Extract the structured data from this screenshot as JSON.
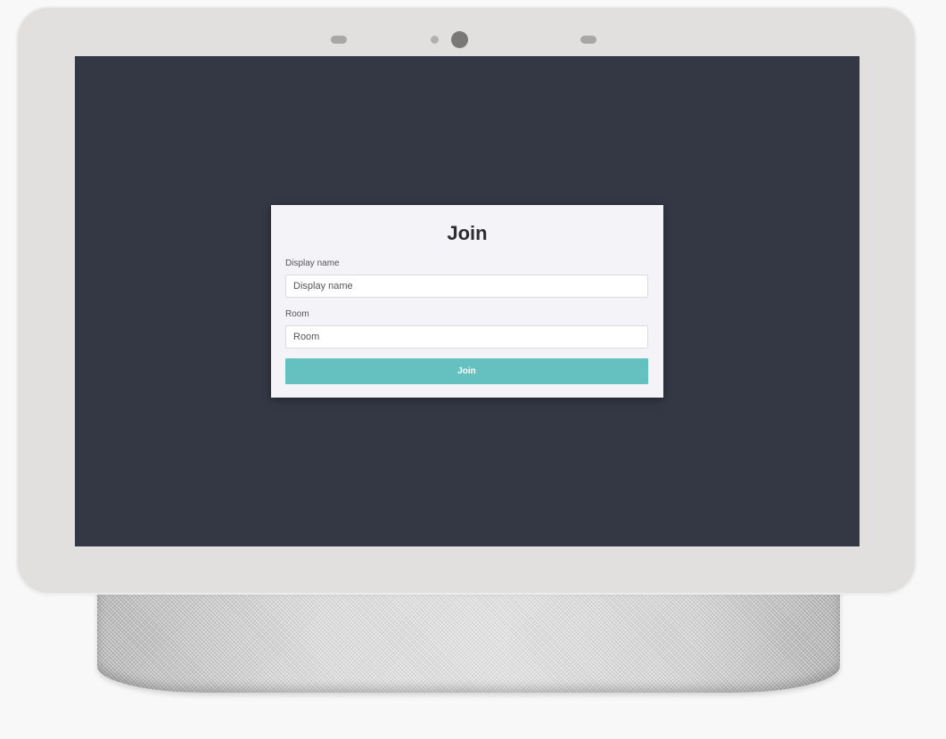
{
  "dialog": {
    "title": "Join",
    "display_name": {
      "label": "Display name",
      "placeholder": "Display name",
      "value": ""
    },
    "room": {
      "label": "Room",
      "placeholder": "Room",
      "value": ""
    },
    "join_button_label": "Join"
  },
  "colors": {
    "screen_background": "#343744",
    "dialog_background": "#f4f4f8",
    "accent": "#65c0c0",
    "device_frame": "#e2e0df"
  },
  "icons": [
    "camera-icon",
    "sensor-icon"
  ]
}
